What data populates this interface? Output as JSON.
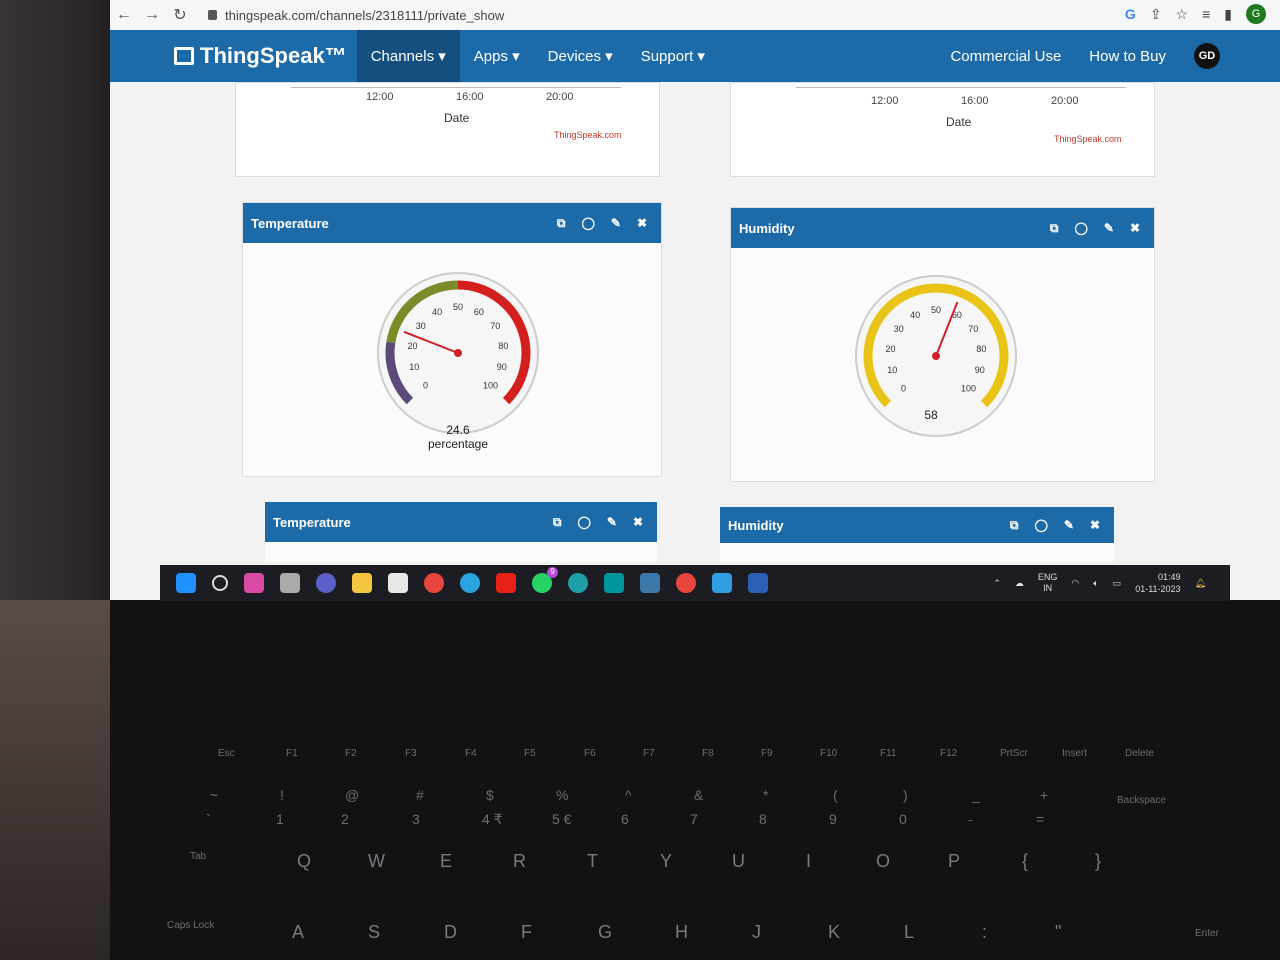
{
  "browser": {
    "url": "thingspeak.com/channels/2318111/private_show",
    "profile_initial": "G"
  },
  "nav": {
    "brand": "ThingSpeak™",
    "items": [
      "Channels ▾",
      "Apps ▾",
      "Devices ▾",
      "Support ▾"
    ],
    "right": [
      "Commercial Use",
      "How to Buy"
    ],
    "user_badge": "GD"
  },
  "top_charts": [
    {
      "ticks": [
        "12:00",
        "16:00",
        "20:00"
      ],
      "xlabel": "Date",
      "credit": "ThingSpeak.com"
    },
    {
      "ticks": [
        "12:00",
        "16:00",
        "20:00"
      ],
      "xlabel": "Date",
      "credit": "ThingSpeak.com"
    }
  ],
  "widgets": [
    {
      "title": "Temperature",
      "value": "24.6",
      "unit": "percentage",
      "gauge_value": 24.6,
      "ticks": [
        "0",
        "10",
        "20",
        "30",
        "40",
        "50",
        "60",
        "70",
        "80",
        "90",
        "100"
      ]
    },
    {
      "title": "Humidity",
      "value": "58",
      "unit": "",
      "gauge_value": 58,
      "ticks": [
        "0",
        "10",
        "20",
        "30",
        "40",
        "50",
        "60",
        "70",
        "80",
        "90",
        "100"
      ]
    }
  ],
  "lower_widgets": [
    "Temperature",
    "Humidity"
  ],
  "taskbar": {
    "lang_top": "ENG",
    "lang_bottom": "IN",
    "time": "01:49",
    "date": "01-11-2023",
    "badge_count": "9"
  },
  "keyboard": {
    "fn_row": [
      "Esc",
      "F1",
      "F2",
      "F3",
      "F4",
      "F5",
      "F6",
      "F7",
      "F8",
      "F9",
      "F10",
      "F11",
      "F12",
      "PrtScr",
      "Insert",
      "Delete"
    ],
    "num_row_top": [
      "~",
      "!",
      "@",
      "#",
      "$",
      "%",
      "^",
      "&",
      "*",
      "(",
      ")",
      "_",
      "+"
    ],
    "num_row_bottom": [
      "`",
      "1",
      "2",
      "3",
      "4 ₹",
      "5 €",
      "6",
      "7",
      "8",
      "9",
      "0",
      "-",
      "="
    ],
    "backspace": "Backspace",
    "tab": "Tab",
    "qwerty": [
      "Q",
      "W",
      "E",
      "R",
      "T",
      "Y",
      "U",
      "I",
      "O",
      "P",
      "{",
      "}"
    ],
    "caps": "Caps Lock",
    "asdf": [
      "A",
      "S",
      "D",
      "F",
      "G",
      "H",
      "J",
      "K",
      "L",
      ":",
      "\""
    ],
    "enter": "Enter"
  }
}
